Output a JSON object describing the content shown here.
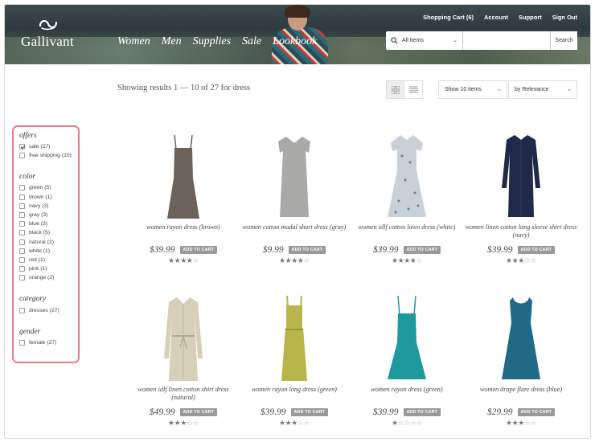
{
  "brand": {
    "name": "Gallivant",
    "logo_icon": "swirl-logo-icon"
  },
  "topnav": [
    "Shopping Cart (6)",
    "Account",
    "Support",
    "Sign Out"
  ],
  "mainnav": [
    "Women",
    "Men",
    "Supplies",
    "Sale",
    "Lookbook"
  ],
  "search": {
    "scope": "All Items",
    "placeholder": "",
    "button": "Search"
  },
  "toolbar": {
    "results_text": "Showing results 1 — 10 of 27 for dress",
    "per_page": "Show 10 items",
    "sort": "by Relevance",
    "view": "grid"
  },
  "filters": [
    {
      "title": "offers",
      "options": [
        {
          "label": "sale (27)",
          "checked": true
        },
        {
          "label": "free shipping (10)",
          "checked": false
        }
      ]
    },
    {
      "title": "color",
      "options": [
        {
          "label": "green (5)",
          "checked": false
        },
        {
          "label": "brown (1)",
          "checked": false
        },
        {
          "label": "navy (3)",
          "checked": false
        },
        {
          "label": "gray (3)",
          "checked": false
        },
        {
          "label": "blue (3)",
          "checked": false
        },
        {
          "label": "black (5)",
          "checked": false
        },
        {
          "label": "natural (2)",
          "checked": false
        },
        {
          "label": "white (1)",
          "checked": false
        },
        {
          "label": "red (1)",
          "checked": false
        },
        {
          "label": "pink (1)",
          "checked": false
        },
        {
          "label": "orange (2)",
          "checked": false
        }
      ]
    },
    {
      "title": "category",
      "options": [
        {
          "label": "dresses (27)",
          "checked": false
        }
      ]
    },
    {
      "title": "gender",
      "options": [
        {
          "label": "female (27)",
          "checked": false
        }
      ]
    }
  ],
  "add_to_cart_label": "ADD TO CART",
  "products": [
    {
      "name": "women rayon dress (brown)",
      "price": "$39.99",
      "rating": 4,
      "color": "#6b6259"
    },
    {
      "name": "women cotton modal short dress (gray)",
      "price": "$9.99",
      "rating": 4,
      "color": "#a9aaa8"
    },
    {
      "name": "women idlf cotton lawn dress (white)",
      "price": "$39.99",
      "rating": 4,
      "color": "#c9d0d8"
    },
    {
      "name": "women linen cotton long sleeve shirt dress (navy)",
      "price": "$39.99",
      "rating": 3,
      "color": "#1f2a4a"
    },
    {
      "name": "women idlf linen cotton shirt dress (natural)",
      "price": "$49.99",
      "rating": 3,
      "color": "#d8cfb8"
    },
    {
      "name": "women rayon long dress (green)",
      "price": "$39.99",
      "rating": 3,
      "color": "#b8b64a"
    },
    {
      "name": "women rayon dress (green)",
      "price": "$39.99",
      "rating": 1,
      "color": "#1e9a9d"
    },
    {
      "name": "women drape flare dress (blue)",
      "price": "$29.99",
      "rating": 3,
      "color": "#216a86"
    }
  ]
}
